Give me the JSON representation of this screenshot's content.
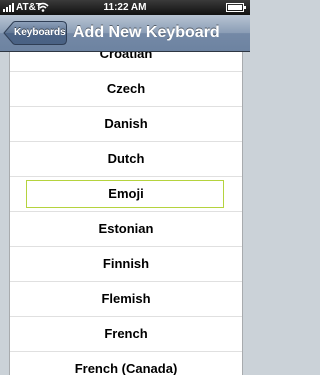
{
  "status_bar": {
    "carrier": "AT&T",
    "time": "11:22 AM"
  },
  "nav": {
    "back_label": "Keyboards",
    "title": "Add New Keyboard"
  },
  "languages": [
    {
      "label": "Croatian",
      "selected": false
    },
    {
      "label": "Czech",
      "selected": false
    },
    {
      "label": "Danish",
      "selected": false
    },
    {
      "label": "Dutch",
      "selected": false
    },
    {
      "label": "Emoji",
      "selected": true
    },
    {
      "label": "Estonian",
      "selected": false
    },
    {
      "label": "Finnish",
      "selected": false
    },
    {
      "label": "Flemish",
      "selected": false
    },
    {
      "label": "French",
      "selected": false
    },
    {
      "label": "French (Canada)",
      "selected": false
    }
  ],
  "colors": {
    "nav_bar": "#7489a6",
    "selection_outline": "#b5d33e"
  }
}
